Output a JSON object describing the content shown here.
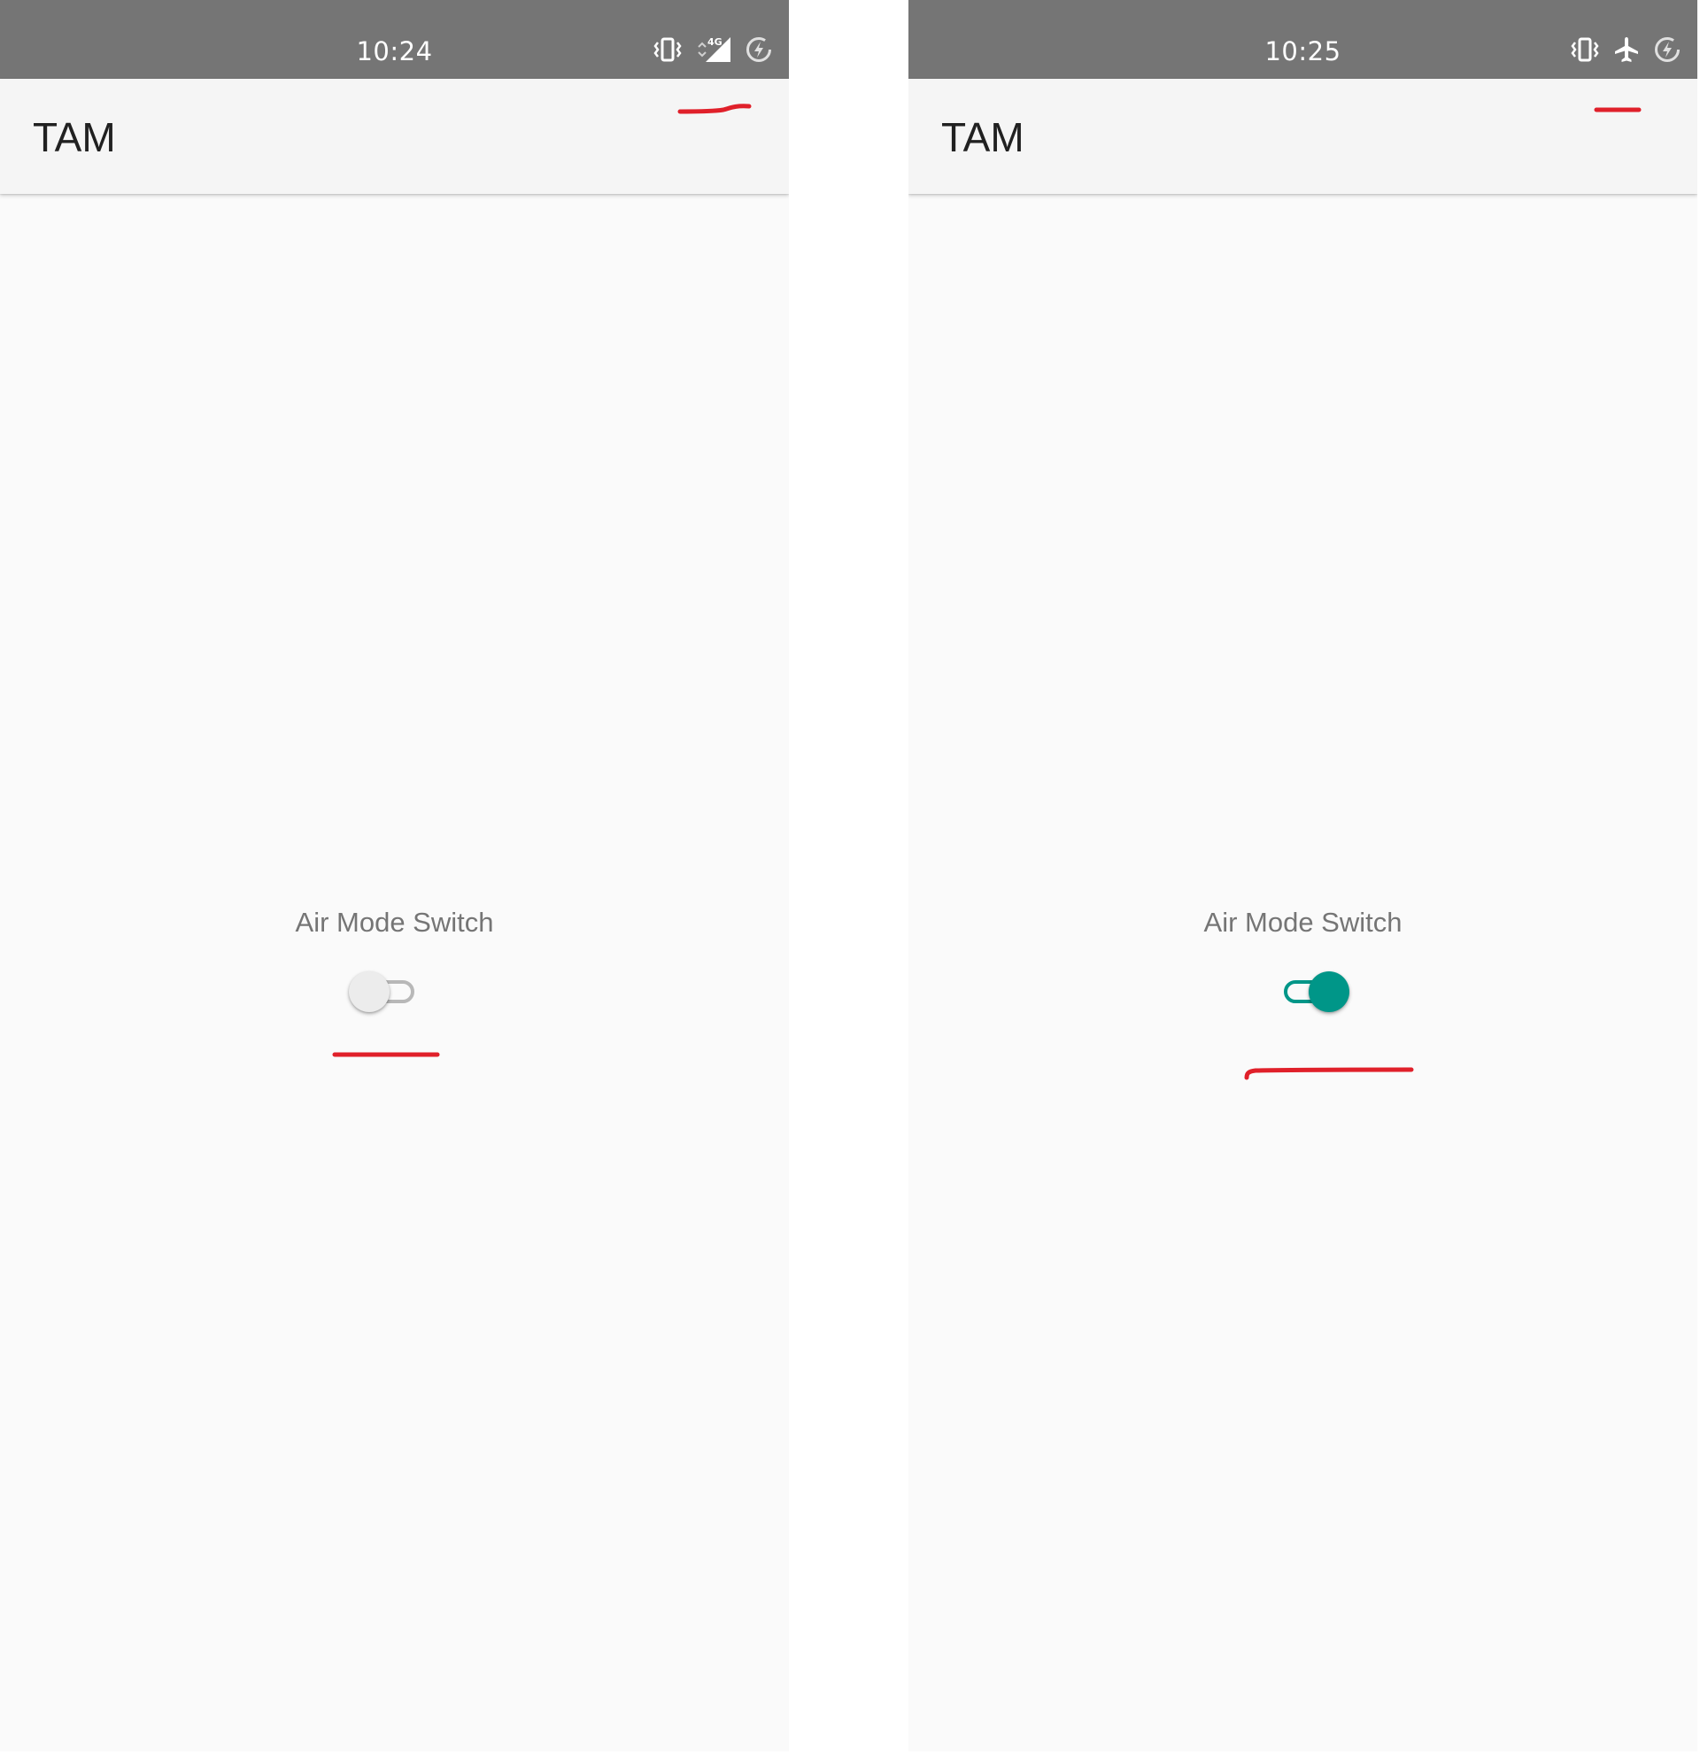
{
  "screens": [
    {
      "status_bar": {
        "time": "10:24",
        "icons": [
          "vibrate-icon",
          "signal-4g-icon",
          "data-saver-icon"
        ],
        "network_label": "4G"
      },
      "app_bar": {
        "title": "TAM"
      },
      "air_mode": {
        "label": "Air Mode Switch",
        "checked": false
      }
    },
    {
      "status_bar": {
        "time": "10:25",
        "icons": [
          "vibrate-icon",
          "airplane-icon",
          "data-saver-icon"
        ]
      },
      "app_bar": {
        "title": "TAM"
      },
      "air_mode": {
        "label": "Air Mode Switch",
        "checked": true
      }
    }
  ],
  "colors": {
    "status_bar": "#757575",
    "app_bar": "#f5f5f5",
    "background": "#fafafa",
    "switch_on": "#009688",
    "switch_off_track": "#b8b8b8",
    "annotation": "#e0202a"
  }
}
